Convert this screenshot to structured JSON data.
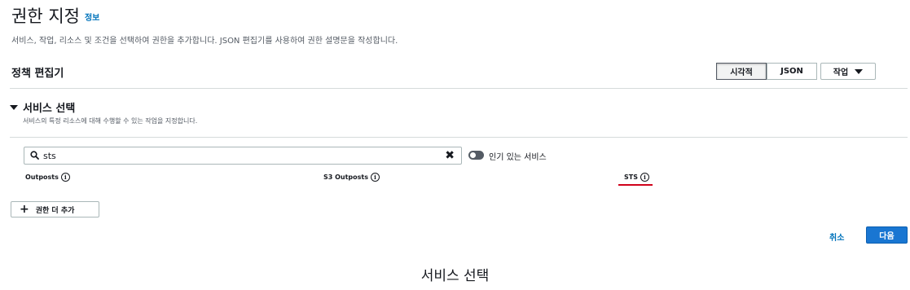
{
  "page": {
    "title": "권한 지정",
    "info_link": "정보",
    "description": "서비스, 작업, 리소스 및 조건을 선택하여 권한을 추가합니다. JSON 편집기를 사용하여 권한 설명문을 작성합니다."
  },
  "editor": {
    "title": "정책 편집기",
    "tabs": [
      {
        "label": "시각적",
        "active": true
      },
      {
        "label": "JSON",
        "active": false
      }
    ],
    "actions_label": "작업"
  },
  "service_section": {
    "title": "서비스 선택",
    "description": "서비스의 특정 리소스에 대해 수행할 수 있는 작업을 지정합니다.",
    "search": {
      "value": "sts",
      "placeholder": ""
    },
    "popular_toggle_label": "인기 있는 서비스",
    "popular_toggle_on": true,
    "results": [
      {
        "label": "Outposts"
      },
      {
        "label": "S3 Outposts"
      },
      {
        "label": "STS",
        "highlighted": true
      }
    ]
  },
  "add_permission_label": "권한 더 추가",
  "footer": {
    "cancel_label": "취소",
    "next_label": "다음"
  },
  "caption": "서비스 선택",
  "colors": {
    "accent": "#1976d2",
    "link": "#0073bb",
    "highlight_underline": "#d0021b"
  },
  "icons": {
    "info": "info-circle-icon",
    "search": "search-icon",
    "clear": "clear-icon",
    "collapse": "caret-down-icon",
    "add": "plus-icon"
  }
}
